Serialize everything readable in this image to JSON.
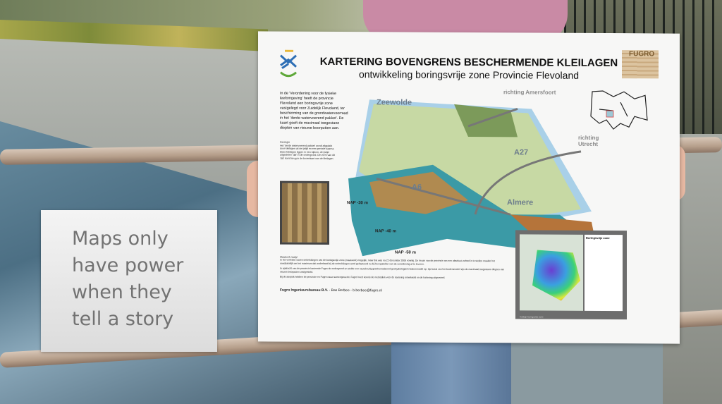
{
  "poster": {
    "title": "KARTERING BOVENGRENS BESCHERMENDE KLEILAGEN",
    "subtitle": "ontwikkeling boringsvrije zone Provincie Flevoland",
    "logo_right": "FUGRO",
    "intro": "In de 'Verordening voor de fysieke leefomgeving' heeft de provincie Flevoland een boringsvrije zone vastgelegd voor Zuidelijk Flevoland, ter bescherming van de grondwatervoorraad in het 'derde watervoerend pakket'. De kaart geeft de maximaal toegestane diepten van nieuwe boorputten aan.",
    "geology_heading": "Geologie",
    "geology_text": "Het 'derde watervoerend pakket' wordt afgedekt door kleilagen uit de ijstijd en een periode daarna. Deze kleilagen liggen in een bijkom, de ijstijd uitgesleten 'dal' in de ondergrond. De vorm van dit 'dal' komt terug in de bovenkant van de kleilagen.",
    "map_labels": {
      "zeewolde": "Zeewolde",
      "amersfoort": "richting Amersfoort",
      "utrecht": "richting Utrecht",
      "a27": "A27",
      "a6": "A6",
      "almere": "Almere",
      "nap30": "NAP -30 m",
      "nap40": "NAP -40 m",
      "nap50": "NAP -50 m"
    },
    "body_heading": "Maatwerk nodig!",
    "body": [
      "In het verleden waren onttrekkingen van de boringsvrije zone (maatwerk) mogelijk, maar dat was na 22 december 2009 voorbij. De keuze van de provincie om een absoluut verbod in te stellen maakte het noodzakelijk om het maximum dat onderhand bij de onttrekkingen werd gehanteerd nu bij het opstellen van de verordening af te leveren.",
      "In opdracht van de provincie karteerde Fugro de ondergrond en stelde een nauwkeurig geschematiseerd geohydrologisch bodemmodel op. Op basis van het bodemmodel zijn de maximaal toegestane diepten van nieuwe boorputten vastgesteld.",
      "Bij de aanpak hebben de provincie en Fugro nauw samengewerkt. Fugro heeft kennis de methodiek voor de kartering ontwikkeld en de kartering uitgevoerd."
    ],
    "legend_title": "Boringsvrije zone",
    "panel_caption": "Huidige boringsvrije zone",
    "footer_company": "Fugro Ingenieursbureau B.V.",
    "footer_contact": "- Bas Berbee - b.berbee@fugro.nl"
  },
  "caption": [
    "Maps only",
    "have power",
    "when they",
    "tell a story"
  ]
}
